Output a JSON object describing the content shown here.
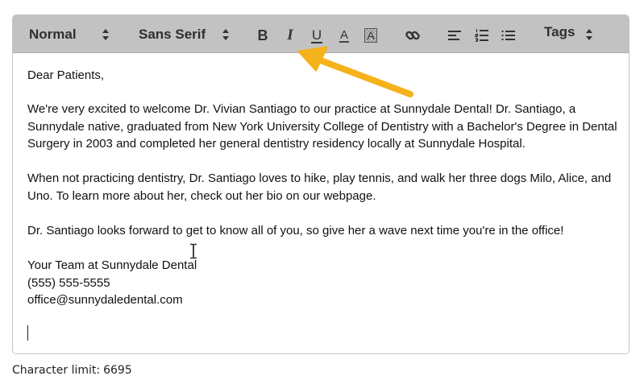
{
  "toolbar": {
    "heading_picker": {
      "label": "Normal",
      "icon": "updown-icon"
    },
    "font_picker": {
      "label": "Sans Serif",
      "icon": "updown-icon"
    },
    "tags_picker": {
      "label": "Tags",
      "icon": "updown-icon"
    },
    "buttons": {
      "bold": {
        "glyph": "B",
        "icon": "bold-icon"
      },
      "italic": {
        "glyph": "I",
        "icon": "italic-icon"
      },
      "underline": {
        "glyph": "U",
        "icon": "underline-icon"
      },
      "text_color": {
        "glyph": "A",
        "icon": "text-color-icon"
      },
      "background_color": {
        "glyph": "A",
        "icon": "background-color-icon"
      },
      "link": {
        "icon": "link-icon"
      },
      "align": {
        "icon": "align-left-icon"
      },
      "ordered_list": {
        "icon": "ordered-list-icon"
      },
      "bullet_list": {
        "icon": "bullet-list-icon"
      }
    },
    "background": "#c2c2c2"
  },
  "content": {
    "greeting": "Dear Patients,",
    "para1": "We're very excited to welcome Dr. Vivian Santiago to our practice at Sunnydale Dental!  Dr. Santiago, a Sunnydale native, graduated from New York University College of Dentistry with a Bachelor's Degree in Dental Surgery in 2003 and completed her general dentistry residency locally at Sunnydale Hospital.",
    "para2": "When not practicing dentistry, Dr. Santiago loves to hike, play tennis, and walk her three dogs Milo, Alice, and Uno.  To learn more about her, check out her bio on our webpage.",
    "para3": "Dr. Santiago looks forward to get to know all of you, so give her a wave next time you're in the office!",
    "signature": [
      "Your Team at Sunnydale Dental",
      "(555) 555-5555",
      "office@sunnydaledental.com"
    ]
  },
  "footer": {
    "label": "Character limit:",
    "value": "6695"
  },
  "annotation": {
    "arrow_color": "#f5b21b",
    "icon": "arrow-annotation"
  }
}
